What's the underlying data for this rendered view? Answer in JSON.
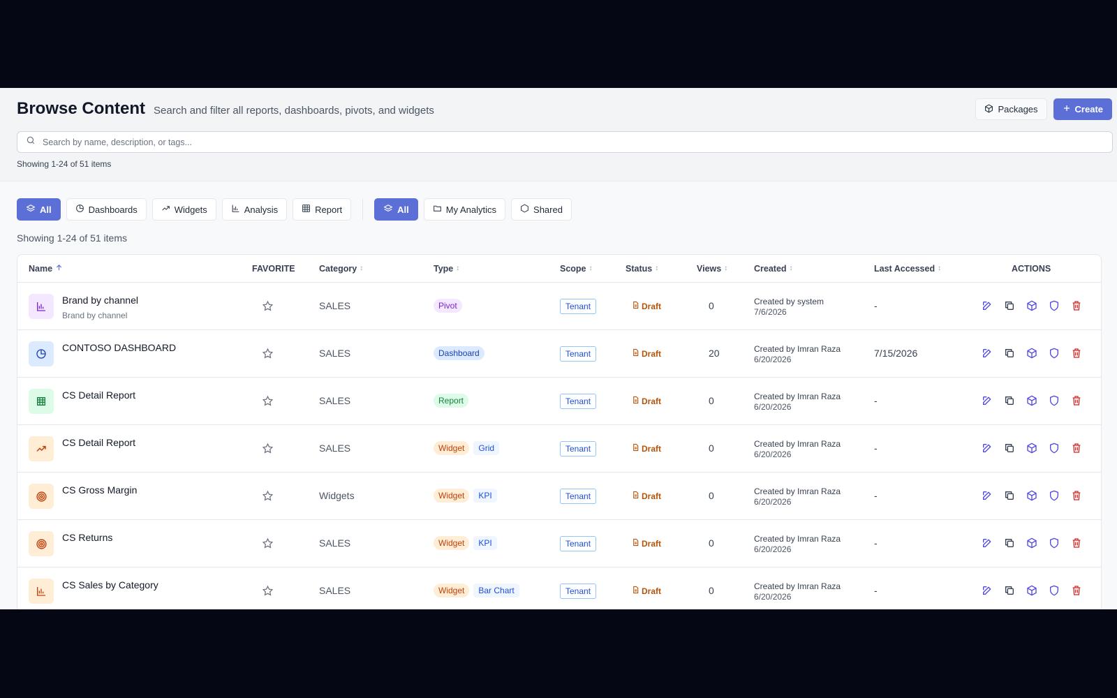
{
  "header": {
    "title": "Browse Content",
    "subtitle": "Search and filter all reports, dashboards, pivots, and widgets",
    "packages_label": "Packages",
    "create_label": "Create"
  },
  "search": {
    "placeholder": "Search by name, description, or tags...",
    "value": ""
  },
  "showing_top": "Showing 1-24 of 51 items",
  "type_filters": [
    "All",
    "Dashboards",
    "Widgets",
    "Analysis",
    "Report"
  ],
  "scope_filters": [
    "All",
    "My Analytics",
    "Shared"
  ],
  "showing_mid": "Showing 1-24 of 51 items",
  "table": {
    "columns": {
      "name": "Name",
      "favorite": "FAVORITE",
      "category": "Category",
      "type": "Type",
      "scope": "Scope",
      "status": "Status",
      "views": "Views",
      "created": "Created",
      "last_accessed": "Last Accessed",
      "actions": "ACTIONS"
    },
    "rows": [
      {
        "name": "Brand by channel",
        "sub": "Brand by channel",
        "icon": "bar-chart-icon",
        "category": "SALES",
        "type": "Pivot",
        "subtype": "",
        "scope": "Tenant",
        "status": "Draft",
        "views": "0",
        "created_by": "Created by system",
        "created_date": "7/6/2026",
        "last_accessed": "-"
      },
      {
        "name": "CONTOSO DASHBOARD",
        "sub": "",
        "icon": "pie-chart-icon",
        "category": "SALES",
        "type": "Dashboard",
        "subtype": "",
        "scope": "Tenant",
        "status": "Draft",
        "views": "20",
        "created_by": "Created by Imran Raza",
        "created_date": "6/20/2026",
        "last_accessed": "7/15/2026"
      },
      {
        "name": "CS Detail Report",
        "sub": "",
        "icon": "table-icon",
        "category": "SALES",
        "type": "Report",
        "subtype": "",
        "scope": "Tenant",
        "status": "Draft",
        "views": "0",
        "created_by": "Created by Imran Raza",
        "created_date": "6/20/2026",
        "last_accessed": "-"
      },
      {
        "name": "CS Detail Report",
        "sub": "",
        "icon": "trend-icon",
        "category": "SALES",
        "type": "Widget",
        "subtype": "Grid",
        "scope": "Tenant",
        "status": "Draft",
        "views": "0",
        "created_by": "Created by Imran Raza",
        "created_date": "6/20/2026",
        "last_accessed": "-"
      },
      {
        "name": "CS Gross Margin",
        "sub": "",
        "icon": "target-icon",
        "category": "Widgets",
        "type": "Widget",
        "subtype": "KPI",
        "scope": "Tenant",
        "status": "Draft",
        "views": "0",
        "created_by": "Created by Imran Raza",
        "created_date": "6/20/2026",
        "last_accessed": "-"
      },
      {
        "name": "CS Returns",
        "sub": "",
        "icon": "target-icon",
        "category": "SALES",
        "type": "Widget",
        "subtype": "KPI",
        "scope": "Tenant",
        "status": "Draft",
        "views": "0",
        "created_by": "Created by Imran Raza",
        "created_date": "6/20/2026",
        "last_accessed": "-"
      },
      {
        "name": "CS Sales by Category",
        "sub": "",
        "icon": "bar-chart-icon",
        "category": "SALES",
        "type": "Widget",
        "subtype": "Bar Chart",
        "scope": "Tenant",
        "status": "Draft",
        "views": "0",
        "created_by": "Created by Imran Raza",
        "created_date": "6/20/2026",
        "last_accessed": "-"
      }
    ]
  },
  "colors": {
    "accent": "#5b6fd6",
    "pivot_bg": "#f3e8ff",
    "pivot_fg": "#7e22ce",
    "dashboard_bg": "#dbeafe",
    "dashboard_fg": "#1e40af",
    "report_bg": "#dcfce7",
    "report_fg": "#15803d",
    "widget_bg": "#ffedd5",
    "widget_fg": "#c2410c",
    "draft": "#b45309",
    "delete": "#dc2626"
  }
}
